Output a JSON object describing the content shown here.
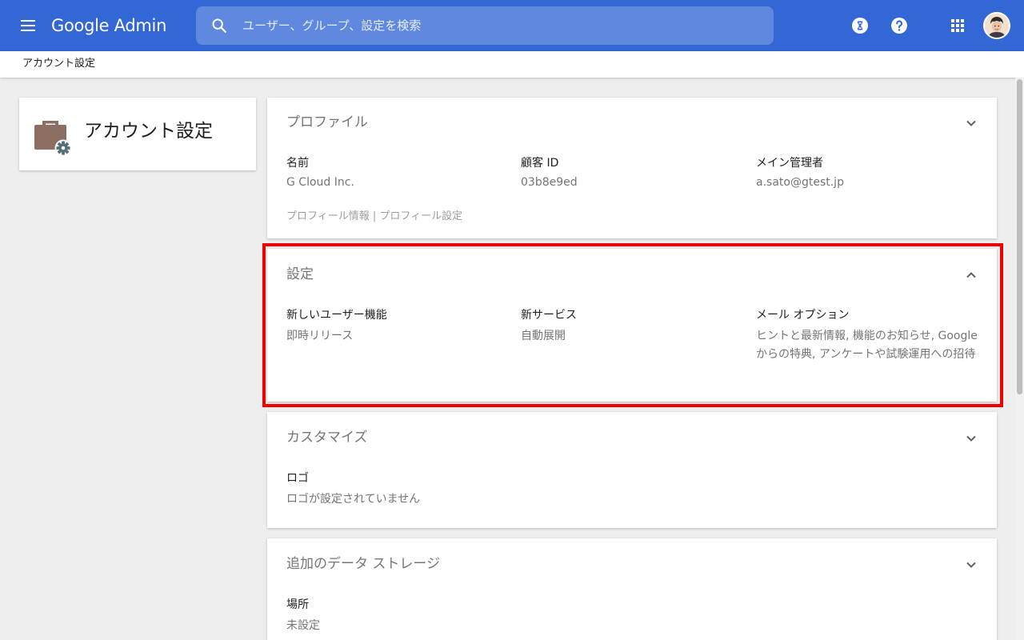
{
  "header": {
    "logo_brand": "Google",
    "logo_product": "Admin",
    "search_placeholder": "ユーザー、グループ、設定を検索",
    "icons": [
      "menu-icon",
      "search-icon",
      "hourglass-icon",
      "help-icon",
      "apps-grid-icon",
      "user-avatar"
    ]
  },
  "breadcrumb": {
    "current": "アカウント設定"
  },
  "sidebar_card": {
    "title": "アカウント設定",
    "icon": "briefcase-gear-icon"
  },
  "profile": {
    "heading": "プロファイル",
    "fields": [
      {
        "label": "名前",
        "value": "G Cloud Inc."
      },
      {
        "label": "顧客 ID",
        "value": "03b8e9ed"
      },
      {
        "label": "メイン管理者",
        "value": "a.sato@gtest.jp"
      }
    ],
    "link_info": "プロフィール情報",
    "link_separator": " | ",
    "link_settings": "プロフィール設定"
  },
  "settings": {
    "heading": "設定",
    "fields": [
      {
        "label": "新しいユーザー機能",
        "value": "即時リリース"
      },
      {
        "label": "新サービス",
        "value": "自動展開"
      },
      {
        "label": "メール オプション",
        "value": "ヒントと最新情報, 機能のお知らせ, Google からの特典, アンケートや試験運用への招待"
      }
    ]
  },
  "customize": {
    "heading": "カスタマイズ",
    "fields": [
      {
        "label": "ロゴ",
        "value": "ロゴが設定されていません"
      }
    ]
  },
  "storage": {
    "heading": "追加のデータ ストレージ",
    "fields": [
      {
        "label": "場所",
        "value": "未設定"
      }
    ]
  },
  "colors": {
    "header_bg": "#3367d6",
    "page_bg": "#eeeeee",
    "highlight_border": "#ee0000",
    "briefcase": "#8d6e63",
    "gear": "#546e7a"
  }
}
